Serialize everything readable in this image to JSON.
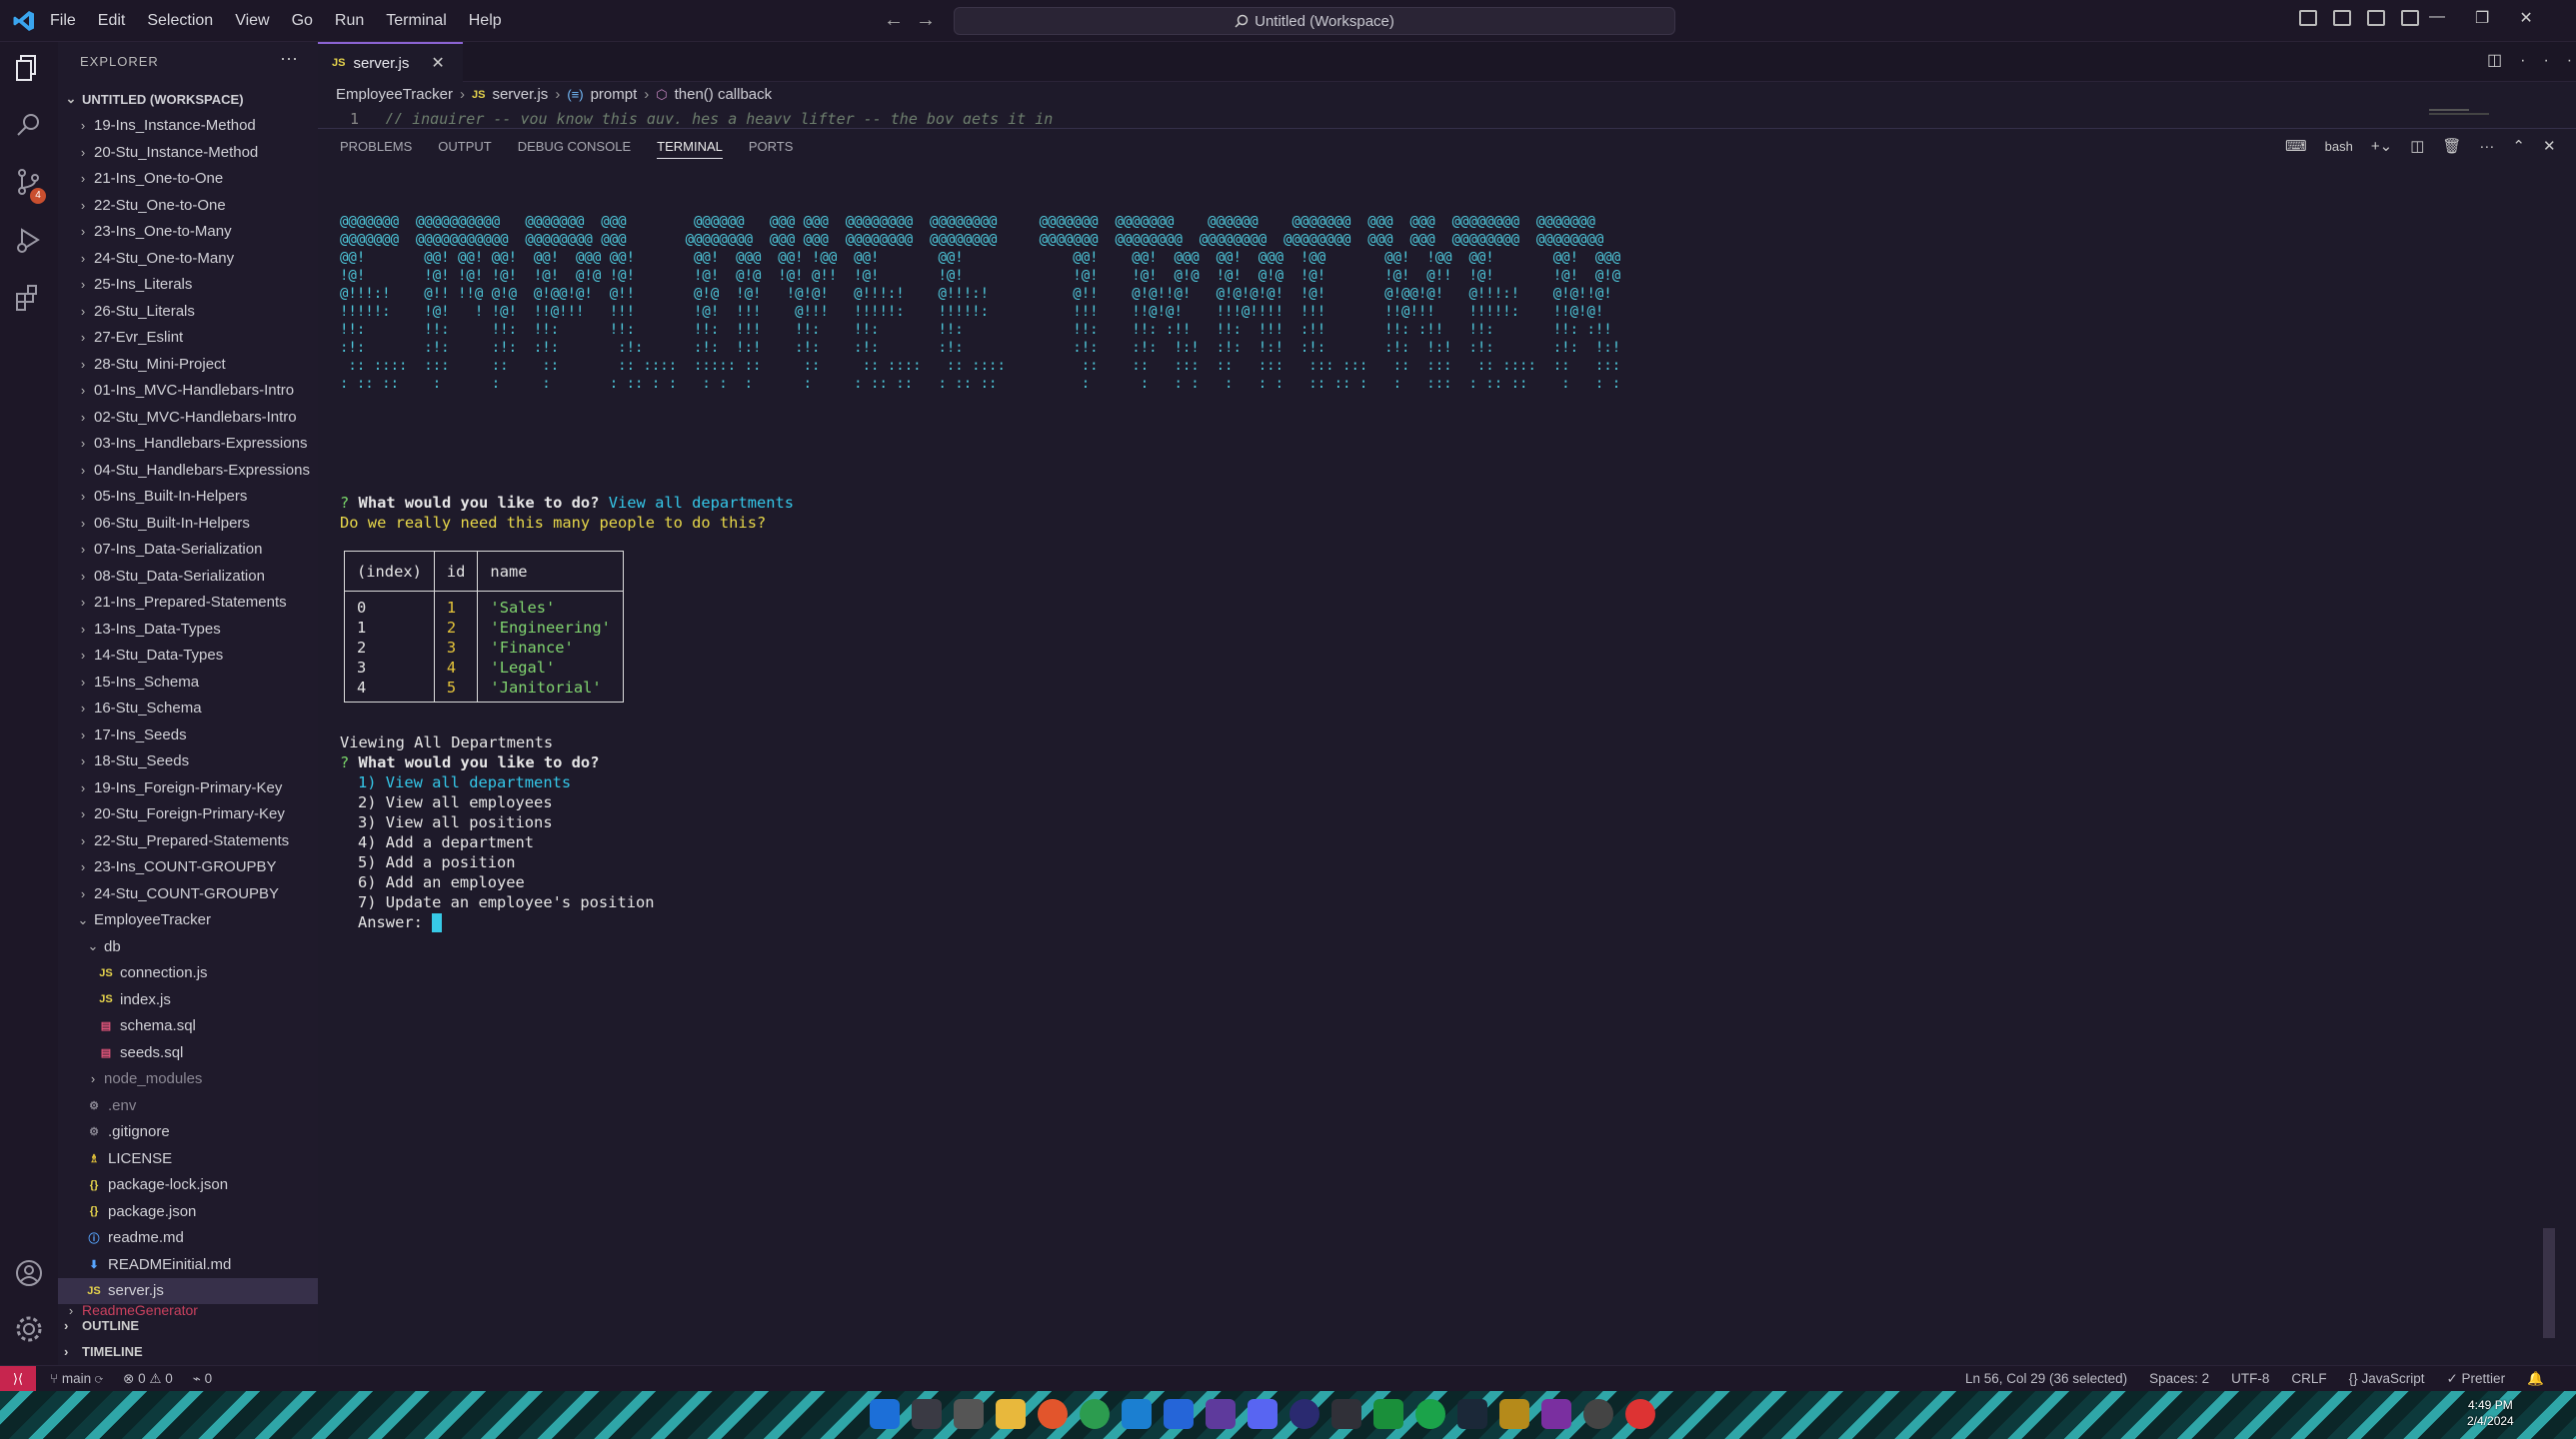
{
  "title": "Untitled (Workspace)",
  "menu": [
    "File",
    "Edit",
    "Selection",
    "View",
    "Go",
    "Run",
    "Terminal",
    "Help"
  ],
  "activity": {
    "scm_badge": "4"
  },
  "explorer": {
    "header": "EXPLORER",
    "workspace": "UNTITLED (WORKSPACE)",
    "folders": [
      "19-Ins_Instance-Method",
      "20-Stu_Instance-Method",
      "21-Ins_One-to-One",
      "22-Stu_One-to-One",
      "23-Ins_One-to-Many",
      "24-Stu_One-to-Many",
      "25-Ins_Literals",
      "26-Stu_Literals",
      "27-Evr_Eslint",
      "28-Stu_Mini-Project",
      "01-Ins_MVC-Handlebars-Intro",
      "02-Stu_MVC-Handlebars-Intro",
      "03-Ins_Handlebars-Expressions",
      "04-Stu_Handlebars-Expressions",
      "05-Ins_Built-In-Helpers",
      "06-Stu_Built-In-Helpers",
      "07-Ins_Data-Serialization",
      "08-Stu_Data-Serialization",
      "21-Ins_Prepared-Statements",
      "13-Ins_Data-Types",
      "14-Stu_Data-Types",
      "15-Ins_Schema",
      "16-Stu_Schema",
      "17-Ins_Seeds",
      "18-Stu_Seeds",
      "19-Ins_Foreign-Primary-Key",
      "20-Stu_Foreign-Primary-Key",
      "22-Stu_Prepared-Statements",
      "23-Ins_COUNT-GROUPBY",
      "24-Stu_COUNT-GROUPBY"
    ],
    "project": "EmployeeTracker",
    "db_folder": "db",
    "db_files": [
      "connection.js",
      "index.js",
      "schema.sql",
      "seeds.sql"
    ],
    "node_modules": "node_modules",
    "files": [
      ".env",
      ".gitignore",
      "LICENSE",
      "package-lock.json",
      "package.json",
      "readme.md",
      "READMEinitial.md",
      "server.js"
    ],
    "next": "ReadmeGenerator",
    "outline": "OUTLINE",
    "timeline": "TIMELINE"
  },
  "tab": {
    "label": "server.js",
    "lang": "JS"
  },
  "breadcrumb": [
    "EmployeeTracker",
    "server.js",
    "prompt",
    "then() callback"
  ],
  "code": {
    "line_no": "1",
    "text": "// inquirer -- you know this guy, hes a heavy lifter -- the boy gets it in"
  },
  "panel": {
    "tabs": [
      "PROBLEMS",
      "OUTPUT",
      "DEBUG CONSOLE",
      "TERMINAL",
      "PORTS"
    ],
    "shell": "bash"
  },
  "terminal": {
    "banner": "@@@@@@@  @@@@@@@@@@   @@@@@@@  @@@        @@@@@@   @@@ @@@  @@@@@@@@  @@@@@@@@     @@@@@@@  @@@@@@@    @@@@@@    @@@@@@@  @@@  @@@  @@@@@@@@  @@@@@@@\n@@@@@@@  @@@@@@@@@@@  @@@@@@@@ @@@       @@@@@@@@  @@@ @@@  @@@@@@@@  @@@@@@@@     @@@@@@@  @@@@@@@@  @@@@@@@@  @@@@@@@@  @@@  @@@  @@@@@@@@  @@@@@@@@\n@@!       @@! @@! @@!  @@!  @@@ @@!       @@!  @@@  @@! !@@  @@!       @@!             @@!    @@!  @@@  @@!  @@@  !@@       @@!  !@@  @@!       @@!  @@@\n!@!       !@! !@! !@!  !@!  @!@ !@!       !@!  @!@  !@! @!!  !@!       !@!             !@!    !@!  @!@  !@!  @!@  !@!       !@!  @!!  !@!       !@!  @!@\n@!!!:!    @!! !!@ @!@  @!@@!@!  @!!       @!@  !@!   !@!@!   @!!!:!    @!!!:!          @!!    @!@!!@!   @!@!@!@!  !@!       @!@@!@!   @!!!:!    @!@!!@!\n!!!!!:    !@!   ! !@!  !!@!!!   !!!       !@!  !!!    @!!!   !!!!!:    !!!!!:          !!!    !!@!@!    !!!@!!!!  !!!       !!@!!!    !!!!!:    !!@!@!\n!!:       !!:     !!:  !!:      !!:       !!:  !!!    !!:    !!:       !!:             !!:    !!: :!!   !!:  !!!  :!!       !!: :!!   !!:       !!: :!!\n:!:       :!:     :!:  :!:       :!:      :!:  !:!    :!:    :!:       :!:             :!:    :!:  !:!  :!:  !:!  :!:       :!:  !:!  :!:       :!:  !:!\n :: ::::  :::     ::    ::       :: ::::  ::::: ::     ::     :: ::::   :: ::::         ::    ::   :::  ::   :::   ::: :::   ::  :::   :: ::::  ::   :::\n: :: ::    :      :     :       : :: : :   : :  :      :     : :: ::   : :: ::          :      :   : :   :   : :   :: :: :   :   :::  : :: ::    :   : :",
    "q1_mark": "? ",
    "q1_question": "What would you like to do? ",
    "q1_answer": "View all departments",
    "comment": "Do we really need this many people to do this?",
    "table_headers": [
      "(index)",
      "id",
      "name"
    ],
    "table_rows": [
      {
        "index": "0",
        "id": "1",
        "name": "'Sales'"
      },
      {
        "index": "1",
        "id": "2",
        "name": "'Engineering'"
      },
      {
        "index": "2",
        "id": "3",
        "name": "'Finance'"
      },
      {
        "index": "3",
        "id": "4",
        "name": "'Legal'"
      },
      {
        "index": "4",
        "id": "5",
        "name": "'Janitorial'"
      }
    ],
    "viewing": "Viewing All Departments",
    "q2_mark": "? ",
    "q2_question": "What would you like to do?",
    "options": [
      "1) View all departments",
      "2) View all employees",
      "3) View all positions",
      "4) Add a department",
      "5) Add a position",
      "6) Add an employee",
      "7) Update an employee's position"
    ],
    "answer_label": "Answer: "
  },
  "status": {
    "branch": "main",
    "errors": "0",
    "warnings": "0",
    "ports": "0",
    "position": "Ln 56, Col 29 (36 selected)",
    "spaces": "Spaces: 2",
    "encoding": "UTF-8",
    "eol": "CRLF",
    "language": "JavaScript",
    "prettier": "Prettier"
  },
  "clock": {
    "time": "4:49 PM",
    "date": "2/4/2024"
  }
}
